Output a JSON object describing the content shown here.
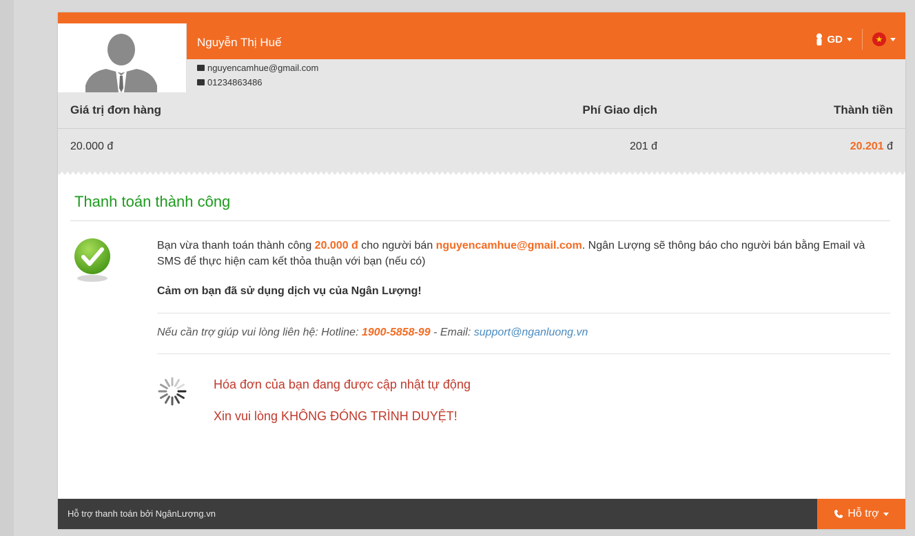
{
  "user": {
    "name": "Nguyễn Thị Huế",
    "email": "nguyencamhue@gmail.com",
    "phone": "01234863486"
  },
  "header": {
    "user_menu_label": "GD",
    "language": "Vietnamese"
  },
  "order_table": {
    "headers": [
      "Giá trị đơn hàng",
      "Phí Giao dịch",
      "Thành tiền"
    ],
    "order_value": "20.000 đ",
    "fee": "201 đ",
    "total_amount": "20.201",
    "total_currency": "đ"
  },
  "result": {
    "title": "Thanh toán thành công",
    "msg_part1": "Bạn vừa thanh toán thành công ",
    "msg_amount": "20.000 đ",
    "msg_part2": " cho người bán ",
    "msg_seller": "nguyencamhue@gmail.com",
    "msg_part3": ". Ngân Lượng sẽ thông báo cho người bán bằng Email và SMS để thực hiện cam kết thỏa thuận với bạn (nếu có)",
    "thanks": "Cảm ơn bạn đã sử dụng dịch vụ của Ngân Lượng!",
    "help_prefix": "Nếu cần trợ giúp vui lòng liên hệ: Hotline: ",
    "hotline": "1900-5858-99",
    "help_mid": " - Email: ",
    "support_email": "support@nganluong.vn",
    "updating": "Hóa đơn của bạn đang được cập nhật tự động",
    "warning": "Xin vui lòng KHÔNG ĐÓNG TRÌNH DUYỆT!"
  },
  "footer": {
    "text": "Hỗ trợ thanh toán bởi NgânLượng.vn",
    "support_label": "Hỗ trợ"
  },
  "colors": {
    "brand": "#f26b22",
    "success": "#1e9a1e",
    "warning": "#c0392b",
    "footer": "#3d3d3d"
  }
}
